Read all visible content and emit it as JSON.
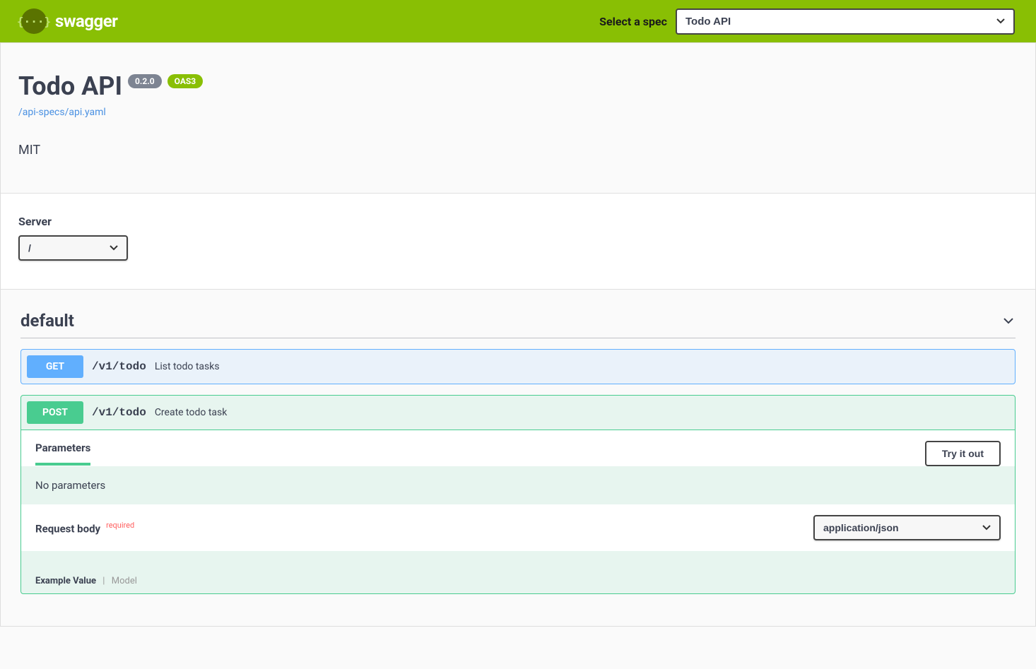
{
  "topbar": {
    "logo_text": "swagger",
    "spec_label": "Select a spec",
    "spec_value": "Todo API"
  },
  "info": {
    "title": "Todo API",
    "version": "0.2.0",
    "oas_version": "OAS3",
    "spec_url": "/api-specs/api.yaml",
    "license": "MIT"
  },
  "server": {
    "label": "Server",
    "value": "/"
  },
  "tag": {
    "name": "default"
  },
  "operations": [
    {
      "method": "GET",
      "path": "/v1/todo",
      "summary": "List todo tasks"
    },
    {
      "method": "POST",
      "path": "/v1/todo",
      "summary": "Create todo task"
    }
  ],
  "post_detail": {
    "parameters_label": "Parameters",
    "try_it_out": "Try it out",
    "no_parameters": "No parameters",
    "request_body_label": "Request body",
    "required_label": "required",
    "content_type": "application/json",
    "example_value_label": "Example Value",
    "model_label": "Model"
  }
}
